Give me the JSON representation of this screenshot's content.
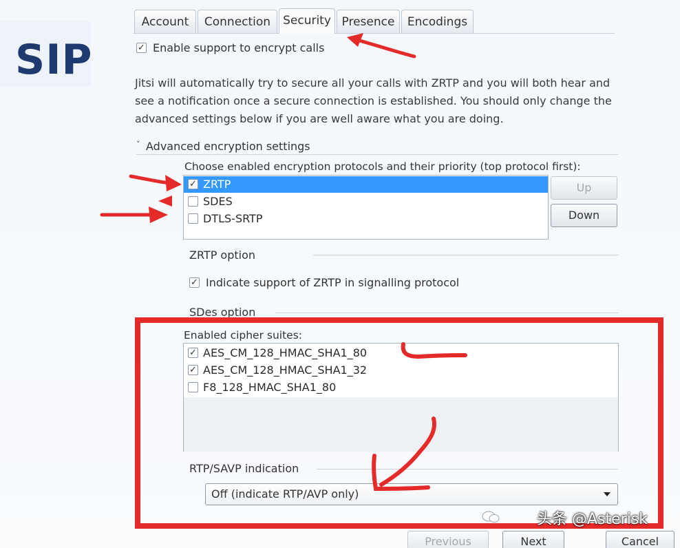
{
  "logo_text": "SIP",
  "tabs": [
    {
      "label": "Account"
    },
    {
      "label": "Connection"
    },
    {
      "label": "Security"
    },
    {
      "label": "Presence"
    },
    {
      "label": "Encodings"
    }
  ],
  "active_tab": "Security",
  "enable_encrypt": {
    "label": "Enable support to encrypt calls",
    "checked": true
  },
  "description": "Jitsi will automatically try to secure all your calls with ZRTP and you will both hear and see a notification once a secure connection is established. You should only change the advanced settings below if you are well aware what you are doing.",
  "advanced": {
    "title": "Advanced encryption settings",
    "protocols_label": "Choose enabled encryption protocols and their priority (top protocol first):",
    "protocols": [
      {
        "label": "ZRTP",
        "checked": true,
        "selected": true
      },
      {
        "label": "SDES",
        "checked": false,
        "selected": false
      },
      {
        "label": "DTLS-SRTP",
        "checked": false,
        "selected": false
      }
    ],
    "up_label": "Up",
    "down_label": "Down"
  },
  "zrtp": {
    "title": "ZRTP option",
    "indicate_label": "Indicate support of ZRTP in signalling protocol",
    "indicate_checked": true
  },
  "sdes": {
    "title": "SDes option",
    "cipher_label": "Enabled cipher suites:",
    "ciphers": [
      {
        "label": "AES_CM_128_HMAC_SHA1_80",
        "checked": true
      },
      {
        "label": "AES_CM_128_HMAC_SHA1_32",
        "checked": true
      },
      {
        "label": "F8_128_HMAC_SHA1_80",
        "checked": false
      }
    ]
  },
  "rtp_savp": {
    "title": "RTP/SAVP indication",
    "selected": "Off (indicate RTP/AVP only)"
  },
  "footer": {
    "previous_label": "Previous",
    "next_label": "Next",
    "cancel_label": "Cancel"
  },
  "watermark": "头条 @Asterisk",
  "colors": {
    "annotation_red": "#e52a2a",
    "selection_blue": "#3399ff",
    "logo_navy": "#1f3a6e"
  }
}
